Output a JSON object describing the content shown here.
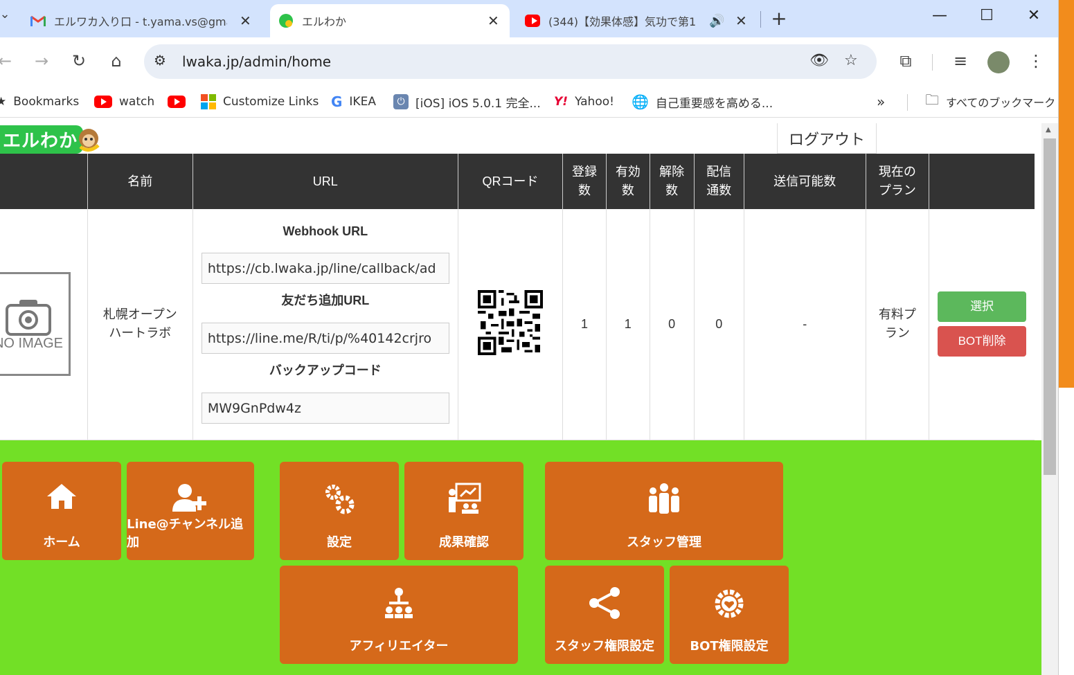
{
  "browser": {
    "tabs": [
      {
        "title": "エルワカ入り口 - t.yama.vs@gmai",
        "icon": "gmail-icon"
      },
      {
        "title": "エルわか",
        "icon": "elwaka-icon"
      },
      {
        "title": "(344)【効果体感】気功で第1",
        "icon": "youtube-icon"
      }
    ],
    "url": "lwaka.jp/admin/home",
    "bookmarks": [
      {
        "label": "Bookmarks",
        "icon": "star-icon"
      },
      {
        "label": "watch",
        "icon": "youtube-icon"
      },
      {
        "label": "",
        "icon": "youtube-icon"
      },
      {
        "label": "Customize Links",
        "icon": "microsoft-icon"
      },
      {
        "label": "IKEA",
        "icon": "google-icon"
      },
      {
        "label": "[iOS] iOS 5.0.1 完全...",
        "icon": "power-icon"
      },
      {
        "label": "Yahoo!",
        "icon": "yahoo-icon"
      },
      {
        "label": "自己重要感を高める...",
        "icon": "globe-icon"
      }
    ],
    "all_bookmarks": "すべてのブックマーク"
  },
  "header": {
    "logo": "エルわか",
    "logout": "ログアウト"
  },
  "table": {
    "headers": {
      "name": "名前",
      "url": "URL",
      "qr": "QRコード",
      "registered": "登録数",
      "valid": "有効数",
      "cancelled": "解除数",
      "sent": "配信通数",
      "sendable": "送信可能数",
      "plan": "現在のプラン"
    },
    "row": {
      "image_placeholder": "NO IMAGE",
      "name": "札幌オープンハートラボ",
      "webhook_label": "Webhook URL",
      "webhook_url": "https://cb.lwaka.jp/line/callback/ad",
      "friend_label": "友だち追加URL",
      "friend_url": "https://line.me/R/ti/p/%40142crjro",
      "backup_label": "バックアップコード",
      "backup_code": "MW9GnPdw4z",
      "registered": "1",
      "valid": "1",
      "cancelled": "0",
      "sent": "0",
      "sendable": "-",
      "plan": "有料プラン",
      "select_button": "選択",
      "delete_button": "BOT削除"
    }
  },
  "menu": {
    "home": "ホーム",
    "add_channel": "Line@チャンネル追加",
    "settings": "設定",
    "results": "成果確認",
    "staff": "スタッフ管理",
    "affiliator": "アフィリエイター",
    "staff_perm": "スタッフ権限設定",
    "bot_perm": "BOT権限設定"
  },
  "colors": {
    "menu_bg": "#72e026",
    "menu_button": "#d5691a",
    "header_bg": "#333333",
    "select": "#5cb85c",
    "delete": "#d9534f"
  }
}
